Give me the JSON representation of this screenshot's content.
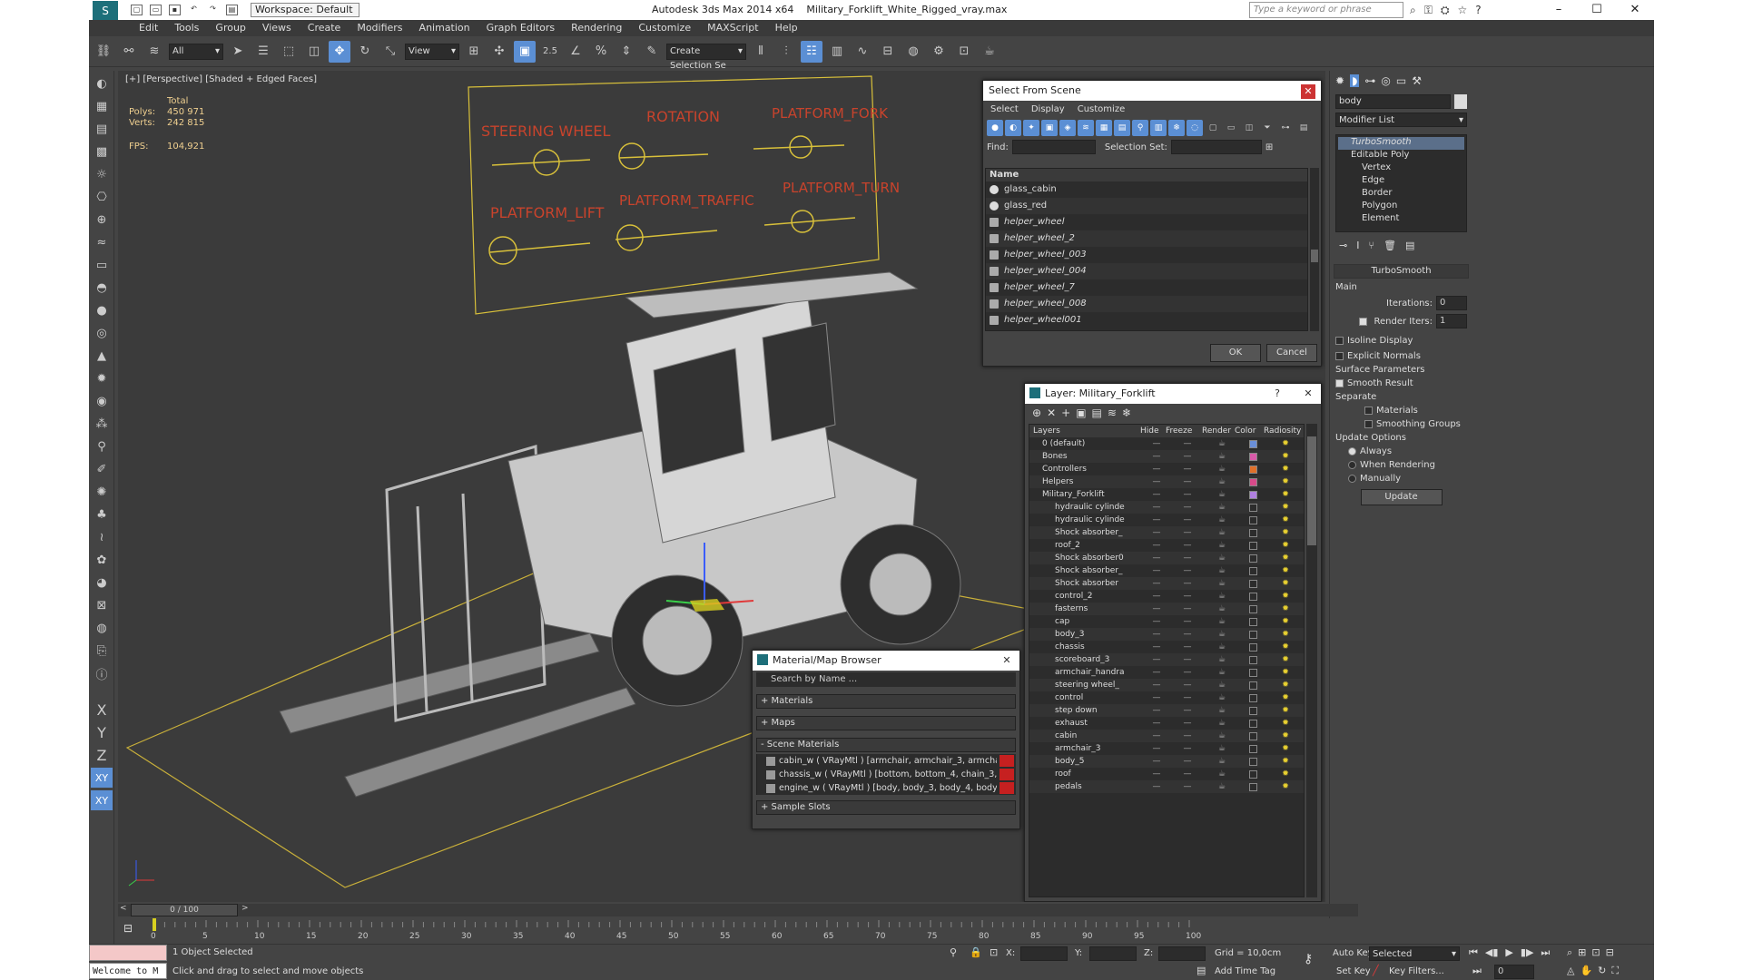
{
  "titlebar": {
    "workspace": "Workspace: Default",
    "app_title": "Autodesk 3ds Max  2014 x64",
    "file_name": "Military_Forklift_White_Rigged_vray.max",
    "search_placeholder": "Type a keyword or phrase"
  },
  "menu": [
    "Edit",
    "Tools",
    "Group",
    "Views",
    "Create",
    "Modifiers",
    "Animation",
    "Graph Editors",
    "Rendering",
    "Customize",
    "MAXScript",
    "Help"
  ],
  "toolbar": {
    "filter": "All",
    "coord": "View",
    "named_selection": "Create Selection Se",
    "snap_angle": "2.5"
  },
  "viewport": {
    "label": "[+] [Perspective] [Shaded + Edged Faces]",
    "stats": {
      "total_label": "Total",
      "polys_label": "Polys:",
      "polys": "450 971",
      "verts_label": "Verts:",
      "verts": "242 815",
      "fps_label": "FPS:",
      "fps": "104,921"
    },
    "controls": [
      "STEERING WHEEL",
      "ROTATION",
      "PLATFORM_FORK",
      "PLATFORM_LIFT",
      "PLATFORM_TRAFFIC",
      "PLATFORM_TURN"
    ]
  },
  "select_scene": {
    "title": "Select From Scene",
    "tabs": [
      "Select",
      "Display",
      "Customize"
    ],
    "find_label": "Find:",
    "selection_set_label": "Selection Set:",
    "column": "Name",
    "items": [
      "glass_cabin",
      "glass_red",
      "helper_wheel",
      "helper_wheel_2",
      "helper_wheel_003",
      "helper_wheel_004",
      "helper_wheel_7",
      "helper_wheel_008",
      "helper_wheel001"
    ],
    "ok": "OK",
    "cancel": "Cancel"
  },
  "layers": {
    "title": "Layer: Military_Forklift",
    "columns": [
      "Layers",
      "Hide",
      "Freeze",
      "Render",
      "Color",
      "Radiosity"
    ],
    "rows": [
      {
        "name": "0 (default)",
        "color": "#6a8fd8",
        "indent": 0
      },
      {
        "name": "Bones",
        "color": "#d85aa8",
        "indent": 0
      },
      {
        "name": "Controllers",
        "color": "#e0702a",
        "indent": 0
      },
      {
        "name": "Helpers",
        "color": "#d84a8a",
        "indent": 0
      },
      {
        "name": "Military_Forklift",
        "color": "#b080e0",
        "indent": 0
      },
      {
        "name": "hydraulic cylinde",
        "color": "#2c2c2c",
        "indent": 1
      },
      {
        "name": "hydraulic cylinde",
        "color": "#2c2c2c",
        "indent": 1
      },
      {
        "name": "Shock absorber_",
        "color": "#2c2c2c",
        "indent": 1
      },
      {
        "name": "roof_2",
        "color": "#2c2c2c",
        "indent": 1
      },
      {
        "name": "Shock absorber0",
        "color": "#2c2c2c",
        "indent": 1
      },
      {
        "name": "Shock absorber_",
        "color": "#2c2c2c",
        "indent": 1
      },
      {
        "name": "Shock absorber",
        "color": "#2c2c2c",
        "indent": 1
      },
      {
        "name": "control_2",
        "color": "#2c2c2c",
        "indent": 1
      },
      {
        "name": "fasterns",
        "color": "#2c2c2c",
        "indent": 1
      },
      {
        "name": "cap",
        "color": "#2c2c2c",
        "indent": 1
      },
      {
        "name": "body_3",
        "color": "#2c2c2c",
        "indent": 1
      },
      {
        "name": "chassis",
        "color": "#2c2c2c",
        "indent": 1
      },
      {
        "name": "scoreboard_3",
        "color": "#2c2c2c",
        "indent": 1
      },
      {
        "name": "armchair_handra",
        "color": "#2c2c2c",
        "indent": 1
      },
      {
        "name": "steering wheel_",
        "color": "#2c2c2c",
        "indent": 1
      },
      {
        "name": "control",
        "color": "#2c2c2c",
        "indent": 1
      },
      {
        "name": "step down",
        "color": "#2c2c2c",
        "indent": 1
      },
      {
        "name": "exhaust",
        "color": "#2c2c2c",
        "indent": 1
      },
      {
        "name": "cabin",
        "color": "#2c2c2c",
        "indent": 1
      },
      {
        "name": "armchair_3",
        "color": "#2c2c2c",
        "indent": 1
      },
      {
        "name": "body_5",
        "color": "#2c2c2c",
        "indent": 1
      },
      {
        "name": "roof",
        "color": "#2c2c2c",
        "indent": 1
      },
      {
        "name": "pedals",
        "color": "#2c2c2c",
        "indent": 1
      }
    ]
  },
  "material_browser": {
    "title": "Material/Map Browser",
    "search_placeholder": "Search by Name ...",
    "sections": [
      "+ Materials",
      "+ Maps",
      "- Scene Materials",
      "+ Sample Slots"
    ],
    "scene_materials": [
      "cabin_w  ( VRayMtl ) [armchair, armchair_3, armchair_handrail,...",
      "chassis_w  ( VRayMtl ) [bottom, bottom_4, chain_3, chassis, ch...",
      "engine_w  ( VRayMtl ) [body, body_3, body_4, body_5, boxes,..."
    ]
  },
  "command_panel": {
    "name_field": "body",
    "modifier_list": "Modifier List",
    "stack": [
      "TurboSmooth",
      "Editable Poly",
      "Vertex",
      "Edge",
      "Border",
      "Polygon",
      "Element"
    ],
    "turbosmooth": {
      "title": "TurboSmooth",
      "main": "Main",
      "iterations_label": "Iterations:",
      "iterations": "0",
      "render_iters_label": "Render Iters:",
      "render_iters": "1",
      "isoline": "Isoline Display",
      "explicit": "Explicit Normals",
      "surface": "Surface Parameters",
      "smooth_result": "Smooth Result",
      "separate": "Separate",
      "materials": "Materials",
      "smoothing_groups": "Smoothing Groups",
      "update_options": "Update Options",
      "always": "Always",
      "when_rendering": "When Rendering",
      "manually": "Manually",
      "update": "Update"
    }
  },
  "timeline": {
    "frame": "0 / 100",
    "ticks": [
      "0",
      "5",
      "10",
      "15",
      "20",
      "25",
      "30",
      "35",
      "40",
      "45",
      "50",
      "55",
      "60",
      "65",
      "70",
      "75",
      "80",
      "85",
      "90",
      "95",
      "100"
    ]
  },
  "status": {
    "welcome": "Welcome to M",
    "selected": "1 Object Selected",
    "prompt": "Click and drag to select and move objects",
    "x_label": "X:",
    "y_label": "Y:",
    "z_label": "Z:",
    "grid": "Grid = 10,0cm",
    "add_time_tag": "Add Time Tag",
    "auto_key": "Auto Key",
    "set_key": "Set Key",
    "selected_dropdown": "Selected",
    "key_filters": "Key Filters...",
    "frame_field": "0"
  }
}
